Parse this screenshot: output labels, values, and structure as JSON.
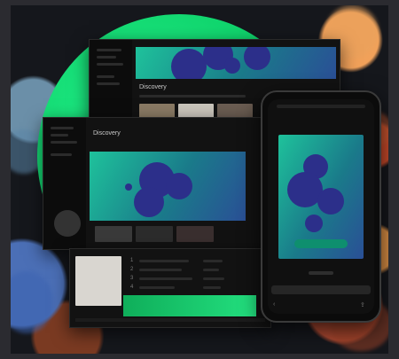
{
  "scene": {
    "colors": {
      "accent_green": "#1ed760",
      "banner_teal": "#1ec29b",
      "banner_blue": "#2a4f96",
      "blob_navy": "#2c2f8a",
      "window_bg": "#121212"
    }
  },
  "desktop_top": {
    "heading": "Discovery"
  },
  "desktop_mid": {
    "heading": "Discovery"
  },
  "tracklist": {
    "rows": [
      {
        "n": "1",
        "title": "",
        "col": ""
      },
      {
        "n": "2",
        "title": "",
        "col": ""
      },
      {
        "n": "3",
        "title": "",
        "col": ""
      },
      {
        "n": "4",
        "title": "",
        "col": ""
      }
    ]
  },
  "phone": {
    "cta_label": "",
    "icons": [
      "back-icon",
      "share-icon"
    ]
  }
}
